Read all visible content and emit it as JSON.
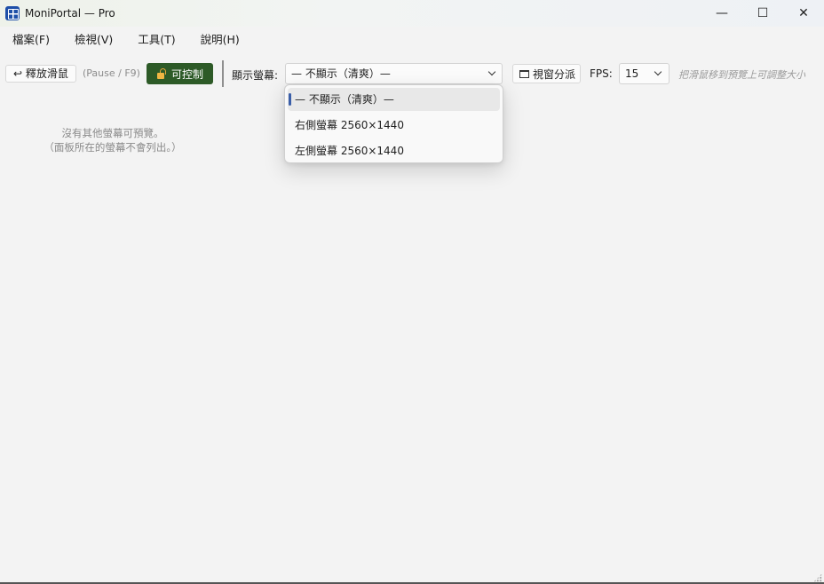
{
  "window": {
    "title": "MoniPortal — Pro",
    "controls": {
      "minimize": "—",
      "maximize": "☐",
      "close": "✕"
    }
  },
  "menu": [
    "檔案(F)",
    "檢視(V)",
    "工具(T)",
    "說明(H)"
  ],
  "toolbar": {
    "release_label": "↩ 釋放滑鼠",
    "hotkey_hint": "(Pause / F9)",
    "control_label": "可控制",
    "control_icon": "unlock-icon",
    "display_label": "顯示螢幕:",
    "display_selected": "— 不顯示（清爽）—",
    "split_label": "視窗分派",
    "fps_label": "FPS:",
    "fps_value": "15",
    "resize_hint": "把滑鼠移到預覽上可調整大小"
  },
  "empty_message": {
    "line1": "沒有其他螢幕可預覽。",
    "line2": "（面板所在的螢幕不會列出。）"
  },
  "dropdown": {
    "options": [
      "— 不顯示（清爽）—",
      "右側螢幕  2560×1440",
      "左側螢幕  2560×1440"
    ],
    "selected_index": 0
  },
  "colors": {
    "control_button": "#2d5a27",
    "accent": "#3a5ea8",
    "lock": "#f0b643"
  }
}
